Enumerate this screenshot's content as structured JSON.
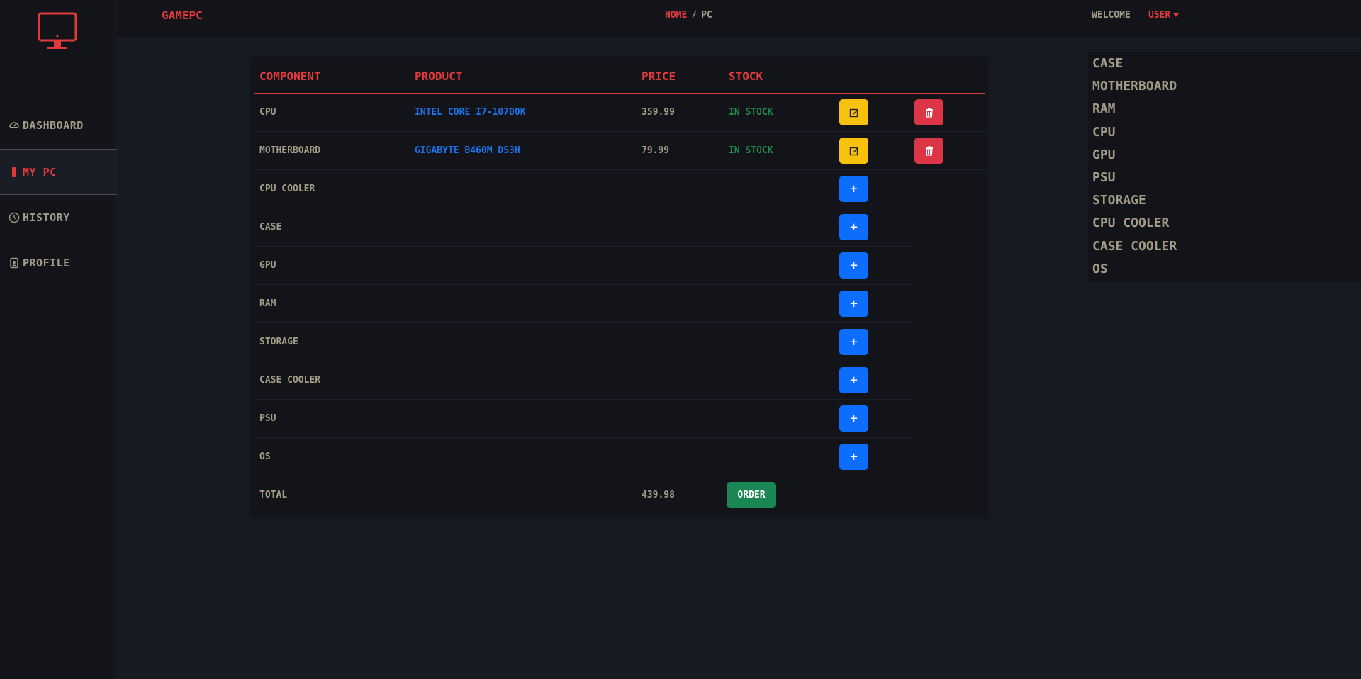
{
  "brand": "GAMEPC",
  "breadcrumb": {
    "home": "HOME",
    "separator": "/",
    "current": "PC"
  },
  "welcome": "WELCOME",
  "user": "USER",
  "sidebar": {
    "items": [
      {
        "label": "DASHBOARD",
        "icon": "speedometer-icon"
      },
      {
        "label": "MY PC",
        "icon": "pc-tower-icon"
      },
      {
        "label": "HISTORY",
        "icon": "clock-icon"
      },
      {
        "label": "PROFILE",
        "icon": "person-badge-icon"
      }
    ]
  },
  "table": {
    "headers": [
      "COMPONENT",
      "PRODUCT",
      "PRICE",
      "STOCK"
    ],
    "rows": [
      {
        "component": "CPU",
        "product": "INTEL CORE I7-10700K",
        "price": "359.99",
        "stock": "IN STOCK"
      },
      {
        "component": "MOTHERBOARD",
        "product": "GIGABYTE B460M DS3H",
        "price": "79.99",
        "stock": "IN STOCK"
      },
      {
        "component": "CPU COOLER"
      },
      {
        "component": "CASE"
      },
      {
        "component": "GPU"
      },
      {
        "component": "RAM"
      },
      {
        "component": "STORAGE"
      },
      {
        "component": "CASE COOLER"
      },
      {
        "component": "PSU"
      },
      {
        "component": "OS"
      }
    ],
    "total": {
      "label": "TOTAL",
      "value": "439.98",
      "order_label": "ORDER"
    }
  },
  "categories": [
    "CASE",
    "MOTHERBOARD",
    "RAM",
    "CPU",
    "GPU",
    "PSU",
    "STORAGE",
    "CPU COOLER",
    "CASE COOLER",
    "OS"
  ],
  "colors": {
    "background": "#171a21",
    "panel": "#12141a",
    "accent_red": "#e03a3a",
    "text_muted": "#a39b86",
    "link_blue": "#1a73e8",
    "stock_green": "#1f8a4c",
    "edit_yellow": "#f7c10d",
    "delete_red": "#dc3545",
    "add_blue": "#0d6efd",
    "order_green": "#1a8754"
  }
}
